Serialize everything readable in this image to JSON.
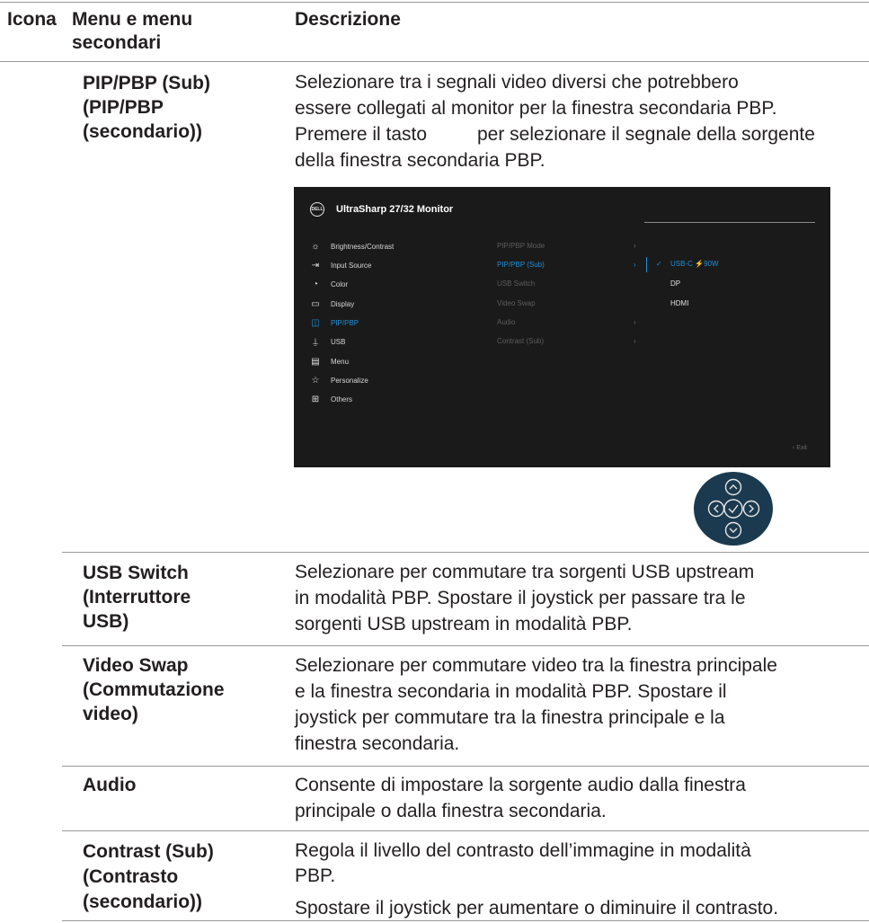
{
  "header": {
    "col_icon": "Icona",
    "col_menu_line1": "Menu e menu",
    "col_menu_line2": "secondari",
    "col_desc": "Descrizione"
  },
  "rows": {
    "pip_sub": {
      "menu": [
        "PIP/PBP (Sub)",
        "(PIP/PBP",
        "(secondario))"
      ],
      "desc": [
        "Selezionare tra i segnali video diversi che potrebbero",
        "essere collegati al monitor per la finestra secondaria PBP.",
        "Premere il tasto",
        "per selezionare il segnale della sorgente",
        "della finestra secondaria PBP."
      ]
    },
    "usb_switch": {
      "menu": [
        "USB Switch",
        "(Interruttore",
        "USB)"
      ],
      "desc": [
        "Selezionare per commutare tra sorgenti USB upstream",
        "in modalità PBP. Spostare il joystick per passare tra le",
        "sorgenti USB upstream in modalità PBP."
      ]
    },
    "video_swap": {
      "menu": [
        "Video Swap",
        "(Commutazione",
        "video)"
      ],
      "desc": [
        "Selezionare per commutare video tra la finestra principale",
        "e la finestra secondaria in modalità PBP. Spostare il",
        "joystick per commutare tra la finestra principale e la",
        "finestra secondaria."
      ]
    },
    "audio": {
      "menu": [
        "Audio"
      ],
      "desc": [
        "Consente di impostare la sorgente audio dalla finestra",
        "principale o dalla finestra secondaria."
      ]
    },
    "contrast_sub": {
      "menu": [
        "Contrast (Sub)",
        "(Contrasto",
        "(secondario))"
      ],
      "desc": [
        "Regola il livello del contrasto dell’immagine in modalità",
        "PBP.",
        "Spostare il joystick per aumentare o diminuire il contrasto."
      ]
    }
  },
  "osd": {
    "logo": "DELL",
    "title": "UltraSharp 27/32 Monitor",
    "left_menu": [
      {
        "label": "Brightness/Contrast",
        "icon": "brightness-icon"
      },
      {
        "label": "Input Source",
        "icon": "input-source-icon"
      },
      {
        "label": "Color",
        "icon": "color-icon"
      },
      {
        "label": "Display",
        "icon": "display-icon"
      },
      {
        "label": "PIP/PBP",
        "icon": "pip-pbp-icon"
      },
      {
        "label": "USB",
        "icon": "usb-icon"
      },
      {
        "label": "Menu",
        "icon": "menu-icon"
      },
      {
        "label": "Personalize",
        "icon": "star-icon"
      },
      {
        "label": "Others",
        "icon": "others-icon"
      }
    ],
    "mid_menu": [
      "PIP/PBP Mode",
      "PIP/PBP (Sub)",
      "USB Switch",
      "Video Swap",
      "Audio",
      "Contrast (Sub)"
    ],
    "right_menu": [
      "USB-C",
      "90W",
      "DP",
      "HDMI"
    ],
    "exit": "Exit",
    "colors": {
      "background": "#1a1a1a",
      "accent": "#1e90d6"
    }
  }
}
